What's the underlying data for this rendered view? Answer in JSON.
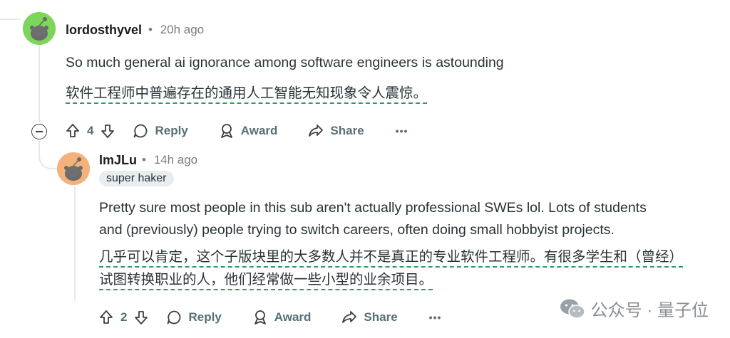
{
  "comment1": {
    "username": "lordosthyvel",
    "separator": "•",
    "time": "20h ago",
    "text_en": "So much general ai ignorance among software engineers is astounding",
    "text_zh": "软件工程师中普遍存在的通用人工智能无知现象令人震惊。",
    "votes": "4",
    "reply_label": "Reply",
    "award_label": "Award",
    "share_label": "Share",
    "more_label": "•••",
    "avatar_color": "#7bd65a"
  },
  "comment2": {
    "username": "ImJLu",
    "separator": "•",
    "time": "14h ago",
    "flair": "super haker",
    "text_en_line1": "Pretty sure most people in this sub aren't actually professional SWEs lol. Lots of students",
    "text_en_line2": "and (previously) people trying to switch careers, often doing small hobbyist projects.",
    "text_zh_line1": "几乎可以肯定，这个子版块里的大多数人并不是真正的专业软件工程师。有很多学生和（曾经）",
    "text_zh_line2": "试图转换职业的人，他们经常做一些小型的业余项目。",
    "votes": "2",
    "reply_label": "Reply",
    "award_label": "Award",
    "share_label": "Share",
    "more_label": "•••",
    "avatar_color": "#f4b27a"
  },
  "watermark": {
    "text": "公众号 · 量子位"
  }
}
